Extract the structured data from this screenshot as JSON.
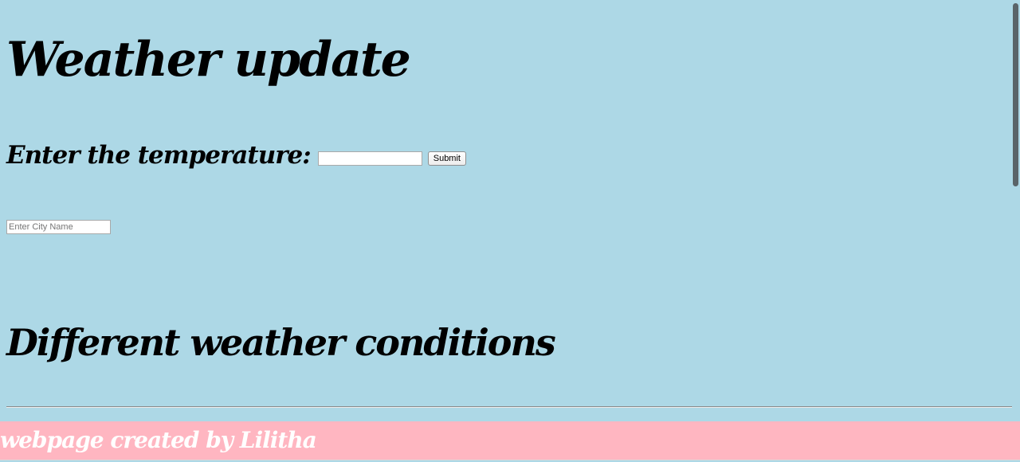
{
  "page": {
    "title": "Weather update",
    "temperature_label": "Enter the temperature:",
    "temperature_input_value": "",
    "submit_label": "Submit",
    "city_input_value": "",
    "city_input_placeholder": "Enter City Name",
    "conditions_heading": "Different weather conditions",
    "footer_text": "webpage created by Lilitha"
  },
  "colors": {
    "background": "#add8e6",
    "footer_background": "#ffb6c1",
    "footer_text": "#ffffff",
    "heading_text": "#000000"
  }
}
